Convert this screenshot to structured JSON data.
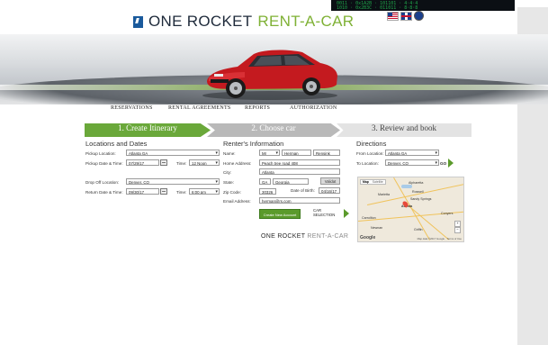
{
  "brand": {
    "name_part1": "ONE ROCKET",
    "name_part2": "RENT-A-CAR",
    "footer_part1": "ONE ROCKET",
    "footer_part2": "RENT-A-CAR"
  },
  "colors": {
    "accent_green": "#6aa83a",
    "brand_blue": "#1a5a9c"
  },
  "nav": [
    "RESERVATIONS",
    "RENTAL AGREEMENTS",
    "REPORTS",
    "AUTHORIZATION"
  ],
  "steps": [
    "1. Create Itinerary",
    "2. Choose car",
    "3. Review and book"
  ],
  "locations": {
    "title": "Locations and Dates",
    "pickup_location_label": "Pickup Location:",
    "pickup_location": "Atlanta GA",
    "pickup_datetime_label": "Pickup Date & Time:",
    "pickup_date": "07/29/17",
    "time_label": "Time:",
    "pickup_time": "12 Noon",
    "dropoff_location_label": "Drop Off Location:",
    "dropoff_location": "Denver, CO",
    "return_datetime_label": "Return Date & Time:",
    "return_date": "09/30/17",
    "return_time_label": "Time:",
    "return_time": "6:00 pm"
  },
  "renter": {
    "title": "Renter's Information",
    "name_label": "Name:",
    "title_value": "Mr",
    "first_name": "Herman",
    "last_name": "Rensink",
    "home_address_label": "Home Address:",
    "home_address": "Peach tree road 408",
    "city_label": "City:",
    "city": "Atlanta",
    "state_label": "State:",
    "state": "GA",
    "state_name": "Georgia",
    "validate_label": "Validat",
    "zip_label": "Zip Code:",
    "zip": "30326",
    "dob_label": "Date of Birth:",
    "dob": "04/16/17",
    "email_label": "Email Address:",
    "email": "herman@rs.com",
    "create_account_label": "Create New Account",
    "car_selection_label": "CAR SELECTION"
  },
  "directions": {
    "title": "Directions",
    "from_label": "From Location:",
    "from": "Atlanta GA",
    "to_label": "To Location:",
    "to": "Denver, CO",
    "go_label": "GO"
  },
  "map": {
    "tab_map": "Map",
    "tab_satellite": "Satellite",
    "cities": [
      "Alpharetta",
      "Marietta",
      "Roswell",
      "Sandy Springs",
      "Atlanta",
      "Conyers",
      "Carrollton",
      "Newnan",
      "Griffin"
    ],
    "google": "Google",
    "attribution": "Map data ©2017 Google · Terms of Use"
  }
}
